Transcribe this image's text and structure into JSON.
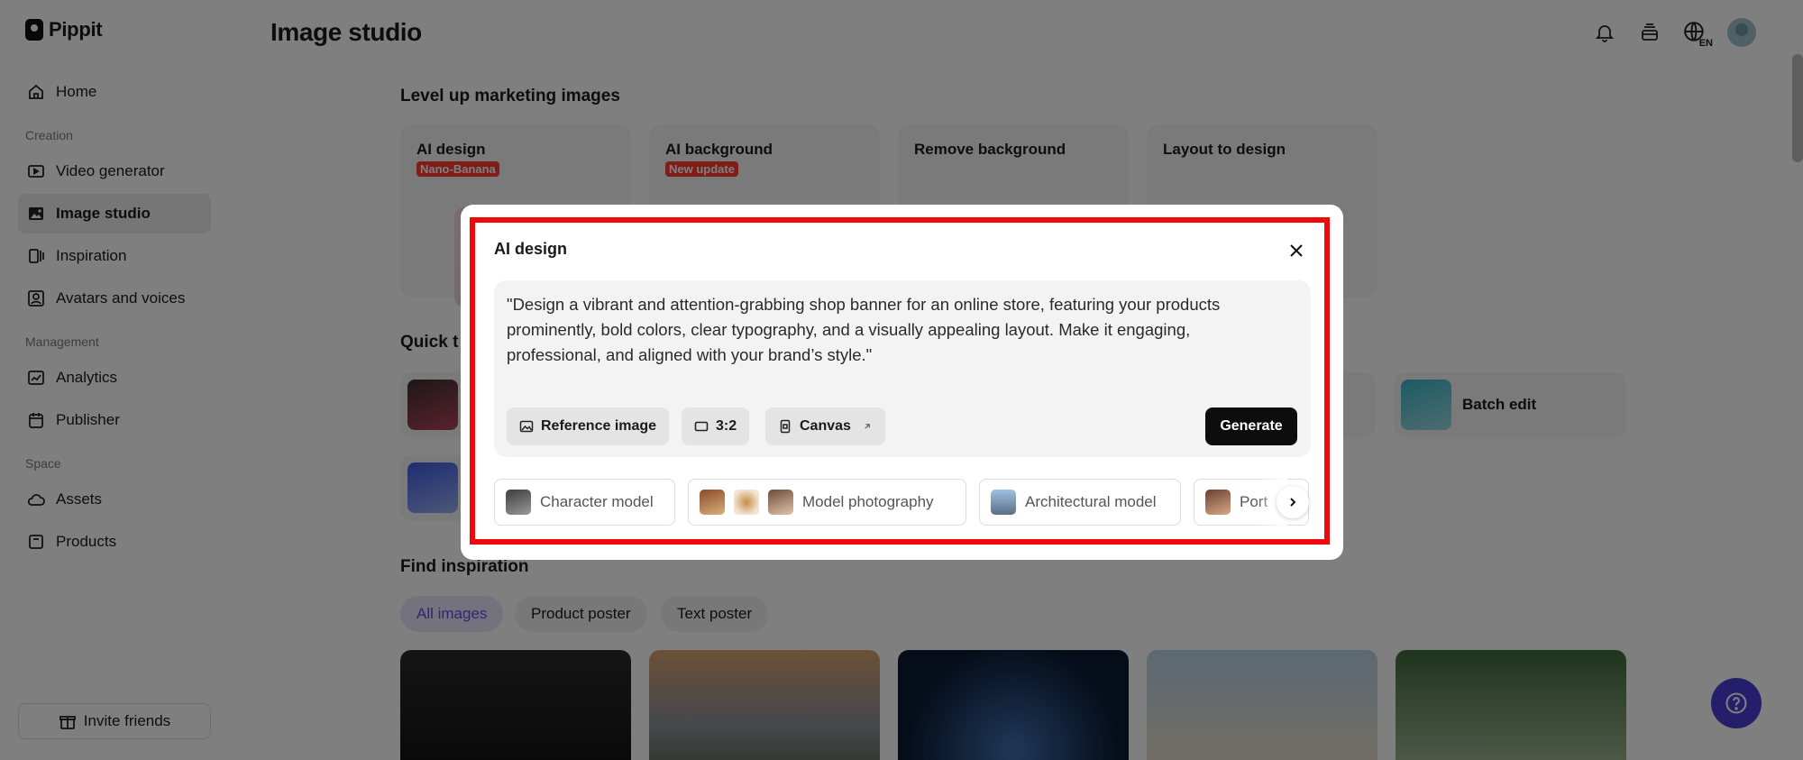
{
  "brand": {
    "name": "Pippit"
  },
  "page": {
    "title": "Image studio"
  },
  "topbar": {
    "lang": "EN"
  },
  "sidebar": {
    "items": [
      {
        "label": "Home"
      },
      {
        "label": "Video generator"
      },
      {
        "label": "Image studio"
      },
      {
        "label": "Inspiration"
      },
      {
        "label": "Avatars and voices"
      },
      {
        "label": "Analytics"
      },
      {
        "label": "Publisher"
      },
      {
        "label": "Assets"
      },
      {
        "label": "Products"
      }
    ],
    "sections": {
      "creation": "Creation",
      "management": "Management",
      "space": "Space"
    },
    "invite": "Invite friends"
  },
  "main": {
    "marketing_title": "Level up marketing images",
    "features": [
      {
        "title": "AI design",
        "badge": "Nano-Banana"
      },
      {
        "title": "AI background",
        "badge": "New update"
      },
      {
        "title": "Remove background",
        "badge": ""
      },
      {
        "title": "Layout to design",
        "badge": ""
      }
    ],
    "quick_title": "Quick t",
    "quick_tools": [
      {
        "label": "Batch edit"
      }
    ],
    "inspiration_title": "Find inspiration",
    "chips": [
      {
        "label": "All images"
      },
      {
        "label": "Product poster"
      },
      {
        "label": "Text poster"
      }
    ]
  },
  "modal": {
    "title": "AI design",
    "prompt": "\"Design a vibrant and attention-grabbing shop banner for an online store, featuring your products prominently, bold colors, clear typography, and a visually appealing layout. Make it engaging, professional, and aligned with your brand’s style.\"",
    "reference_label": "Reference image",
    "ratio_label": "3:2",
    "canvas_label": "Canvas",
    "generate_label": "Generate",
    "presets": [
      {
        "label": "Character model"
      },
      {
        "label": "Model photography"
      },
      {
        "label": "Architectural model"
      },
      {
        "label": "Port"
      }
    ]
  },
  "colors": {
    "highlight": "#ee0a0a",
    "accent": "#5b4fe0",
    "badge": "#ff3b30",
    "help": "#4a3fd6"
  }
}
